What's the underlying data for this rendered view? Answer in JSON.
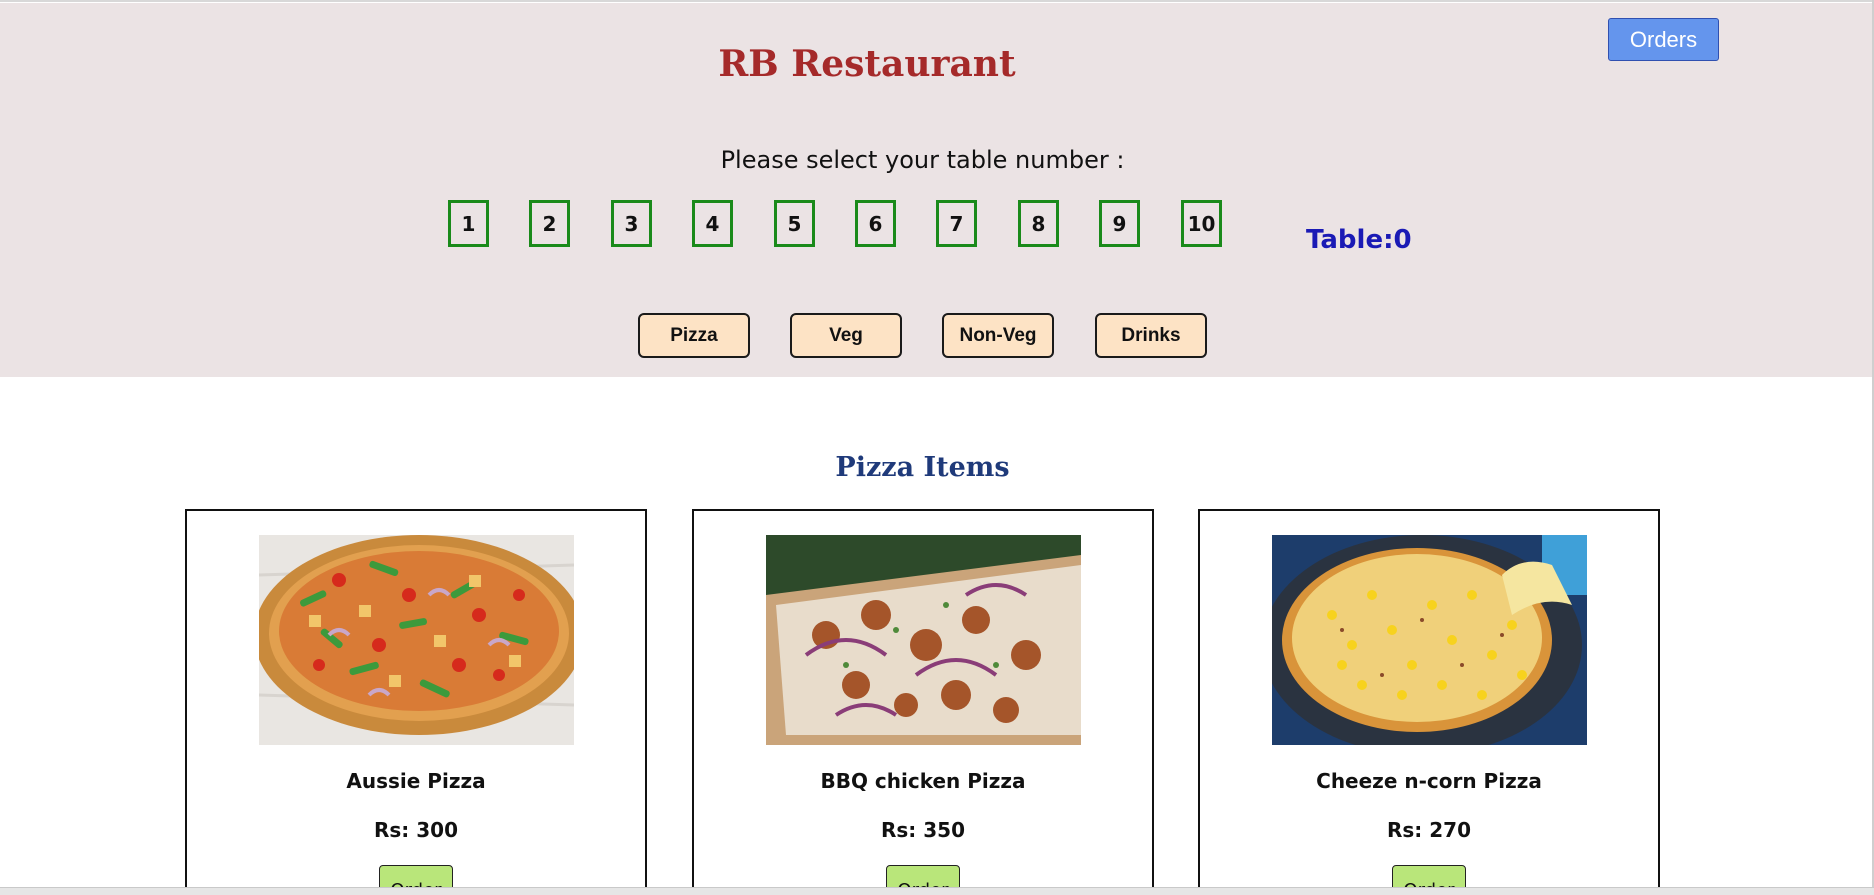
{
  "header": {
    "title": "RB Restaurant",
    "orders_label": "Orders",
    "table_prompt": "Please select your table number :",
    "tables": [
      "1",
      "2",
      "3",
      "4",
      "5",
      "6",
      "7",
      "8",
      "9",
      "10"
    ],
    "table_label": "Table:0",
    "categories": [
      "Pizza",
      "Veg",
      "Non-Veg",
      "Drinks"
    ]
  },
  "menu": {
    "section_title": "Pizza Items",
    "items": [
      {
        "name": "Aussie Pizza",
        "price": "Rs: 300",
        "order_label": "Order"
      },
      {
        "name": "BBQ chicken Pizza",
        "price": "Rs: 350",
        "order_label": "Order"
      },
      {
        "name": "Cheeze n-corn Pizza",
        "price": "Rs: 270",
        "order_label": "Order"
      }
    ]
  },
  "colors": {
    "header_bg": "#ebe3e4",
    "title": "#a52a2a",
    "orders_button": "#6495ed",
    "table_border": "#1a8a1a",
    "table_label": "#1a1ab5",
    "category_button": "#fde3c5",
    "section_title": "#1f3a7a",
    "order_button": "#b9e67a"
  },
  "icons": {
    "item_images": [
      "aussie-pizza-image",
      "bbq-chicken-pizza-image",
      "cheeze-n-corn-pizza-image"
    ]
  }
}
